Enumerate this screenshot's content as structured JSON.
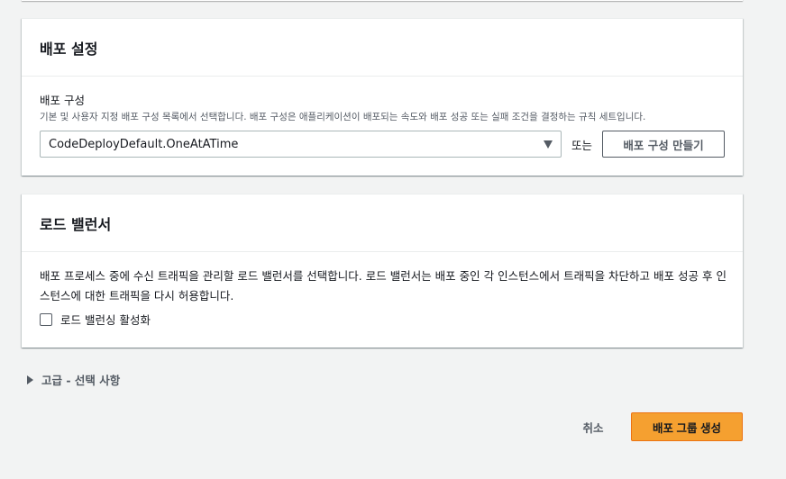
{
  "deploy_settings": {
    "title": "배포 설정",
    "config_label": "배포 구성",
    "config_description": "기본 및 사용자 지정 배포 구성 목록에서 선택합니다. 배포 구성은 애플리케이션이 배포되는 속도와 배포 성공 또는 실패 조건을 결정하는 규칙 세트입니다.",
    "config_selected": "CodeDeployDefault.OneAtATime",
    "or_text": "또는",
    "create_config_button": "배포 구성 만들기"
  },
  "load_balancer": {
    "title": "로드 밸런서",
    "description": "배포 프로세스 중에 수신 트래픽을 관리할 로드 밸런서를 선택합니다. 로드 밸런서는 배포 중인 각 인스턴스에서 트래픽을 차단하고 배포 성공 후 인스턴스에 대한 트래픽을 다시 허용합니다.",
    "checkbox_label": "로드 밸런싱 활성화",
    "checkbox_checked": false
  },
  "advanced": {
    "label": "고급 - 선택 사항"
  },
  "footer": {
    "cancel_label": "취소",
    "create_button": "배포 그룹 생성"
  },
  "colors": {
    "primary_button": "#f5a030",
    "background": "#f2f3f3"
  }
}
